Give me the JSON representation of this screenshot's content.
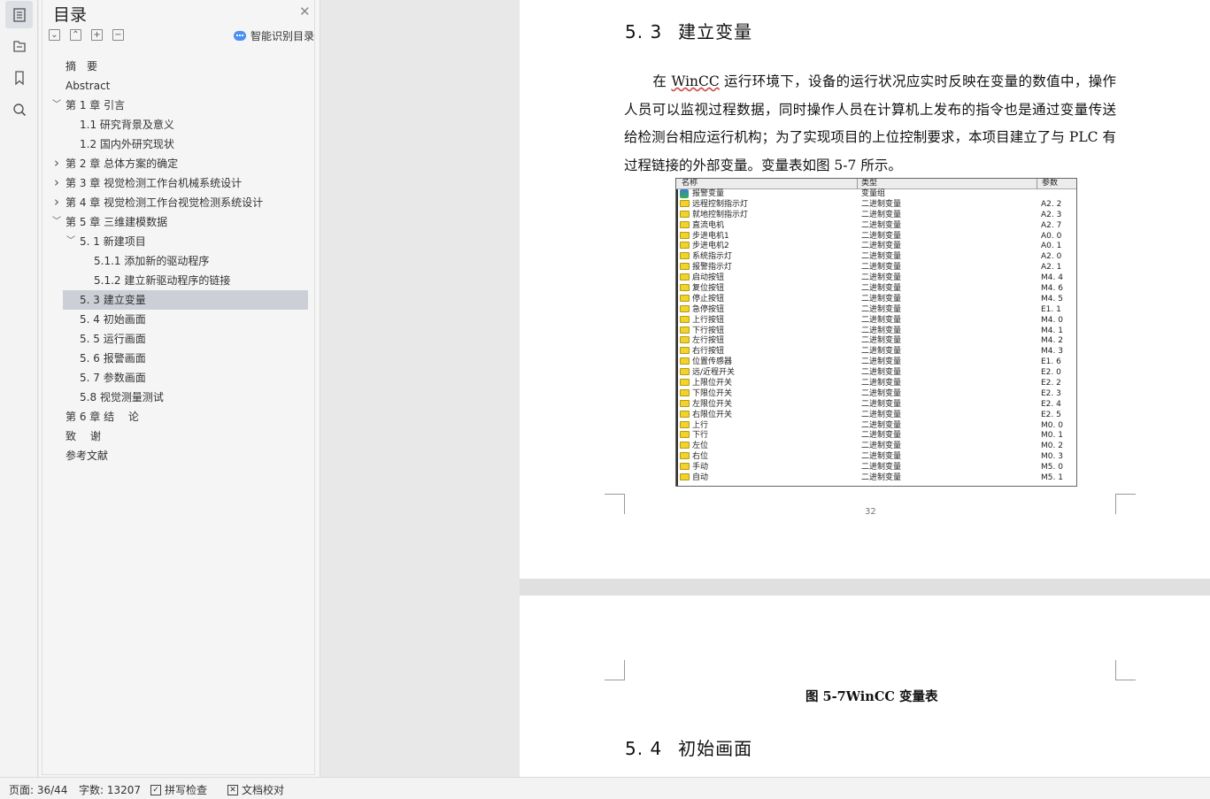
{
  "sidebar_icons": [
    "toc-icon",
    "navigation-icon",
    "bookmark-icon",
    "search-icon"
  ],
  "toc": {
    "title": "目录",
    "tool_labels": [
      "⌄",
      "⌃",
      "+",
      "−"
    ],
    "smart_label": "智能识别目录",
    "items": [
      {
        "label": "摘　要",
        "indent": 0,
        "arrow": ""
      },
      {
        "label": "Abstract",
        "indent": 0,
        "arrow": ""
      },
      {
        "label": "第 1 章  引言",
        "indent": 0,
        "arrow": "v"
      },
      {
        "label": "1.1 研究背景及意义",
        "indent": 1,
        "arrow": ""
      },
      {
        "label": "1.2 国内外研究现状",
        "indent": 1,
        "arrow": ""
      },
      {
        "label": "第 2 章  总体方案的确定",
        "indent": 0,
        "arrow": ">"
      },
      {
        "label": "第 3 章  视觉检测工作台机械系统设计",
        "indent": 0,
        "arrow": ">"
      },
      {
        "label": "第 4 章  视觉检测工作台视觉检测系统设计",
        "indent": 0,
        "arrow": ">"
      },
      {
        "label": "第 5 章  三维建模数据",
        "indent": 0,
        "arrow": "v"
      },
      {
        "label": "5. 1    新建项目",
        "indent": 1,
        "arrow": "v"
      },
      {
        "label": "5.1.1  添加新的驱动程序",
        "indent": 2,
        "arrow": ""
      },
      {
        "label": "5.1.2  建立新驱动程序的链接",
        "indent": 2,
        "arrow": ""
      },
      {
        "label": "5. 3    建立变量",
        "indent": 1,
        "arrow": "",
        "selected": true
      },
      {
        "label": "5. 4    初始画面",
        "indent": 1,
        "arrow": ""
      },
      {
        "label": "5. 5    运行画面",
        "indent": 1,
        "arrow": ""
      },
      {
        "label": "5. 6    报警画面",
        "indent": 1,
        "arrow": ""
      },
      {
        "label": "5. 7    参数画面",
        "indent": 1,
        "arrow": ""
      },
      {
        "label": "5.8    视觉测量测试",
        "indent": 1,
        "arrow": ""
      },
      {
        "label": "第 6 章  结　 论",
        "indent": 0,
        "arrow": ""
      },
      {
        "label": "致　 谢",
        "indent": 0,
        "arrow": ""
      },
      {
        "label": "参考文献",
        "indent": 0,
        "arrow": ""
      }
    ]
  },
  "document": {
    "heading_53_num": "5. 3",
    "heading_53_text": "建立变量",
    "para_pre": "在 ",
    "para_wavy": "WinCC",
    "para_post": " 运行环境下，设备的运行状况应实时反映在变量的数值中，操作人员可以监视过程数据，同时操作人员在计算机上发布的指令也是通过变量传送给检测台相应运行机构；为了实现项目的上位控制要求，本项目建立了与 PLC 有过程链接的外部变量。变量表如图 5-7 所示。",
    "page_number": "32",
    "caption": "图 5-7WinCC 变量表",
    "heading_54_num": "5. 4",
    "heading_54_text": "初始画面",
    "figure": {
      "headers": [
        "名称",
        "类型",
        "参数"
      ],
      "rows": [
        {
          "name": "报警变量",
          "type": "变量组",
          "param": "",
          "group": true
        },
        {
          "name": "远程控制指示灯",
          "type": "二进制变量",
          "param": "A2. 2"
        },
        {
          "name": "就地控制指示灯",
          "type": "二进制变量",
          "param": "A2. 3"
        },
        {
          "name": "直流电机",
          "type": "二进制变量",
          "param": "A2. 7"
        },
        {
          "name": "步进电机1",
          "type": "二进制变量",
          "param": "A0. 0"
        },
        {
          "name": "步进电机2",
          "type": "二进制变量",
          "param": "A0. 1"
        },
        {
          "name": "系统指示灯",
          "type": "二进制变量",
          "param": "A2. 0"
        },
        {
          "name": "报警指示灯",
          "type": "二进制变量",
          "param": "A2. 1"
        },
        {
          "name": "启动按钮",
          "type": "二进制变量",
          "param": "M4. 4"
        },
        {
          "name": "复位按钮",
          "type": "二进制变量",
          "param": "M4. 6"
        },
        {
          "name": "停止按钮",
          "type": "二进制变量",
          "param": "M4. 5"
        },
        {
          "name": "急停按钮",
          "type": "二进制变量",
          "param": "E1. 1"
        },
        {
          "name": "上行按钮",
          "type": "二进制变量",
          "param": "M4. 0"
        },
        {
          "name": "下行按钮",
          "type": "二进制变量",
          "param": "M4. 1"
        },
        {
          "name": "左行按钮",
          "type": "二进制变量",
          "param": "M4. 2"
        },
        {
          "name": "右行按钮",
          "type": "二进制变量",
          "param": "M4. 3"
        },
        {
          "name": "位置传感器",
          "type": "二进制变量",
          "param": "E1. 6"
        },
        {
          "name": "远/近程开关",
          "type": "二进制变量",
          "param": "E2. 0"
        },
        {
          "name": "上限位开关",
          "type": "二进制变量",
          "param": "E2. 2"
        },
        {
          "name": "下限位开关",
          "type": "二进制变量",
          "param": "E2. 3"
        },
        {
          "name": "左限位开关",
          "type": "二进制变量",
          "param": "E2. 4"
        },
        {
          "name": "右限位开关",
          "type": "二进制变量",
          "param": "E2. 5"
        },
        {
          "name": "上行",
          "type": "二进制变量",
          "param": "M0. 0"
        },
        {
          "name": "下行",
          "type": "二进制变量",
          "param": "M0. 1"
        },
        {
          "name": "左位",
          "type": "二进制变量",
          "param": "M0. 2"
        },
        {
          "name": "右位",
          "type": "二进制变量",
          "param": "M0. 3"
        },
        {
          "name": "手动",
          "type": "二进制变量",
          "param": "M5. 0"
        },
        {
          "name": "自动",
          "type": "二进制变量",
          "param": "M5. 1"
        }
      ]
    }
  },
  "status": {
    "page": "页面: 36/44",
    "words": "字数: 13207",
    "spell": "拼写检查",
    "proof": "文档校对"
  }
}
